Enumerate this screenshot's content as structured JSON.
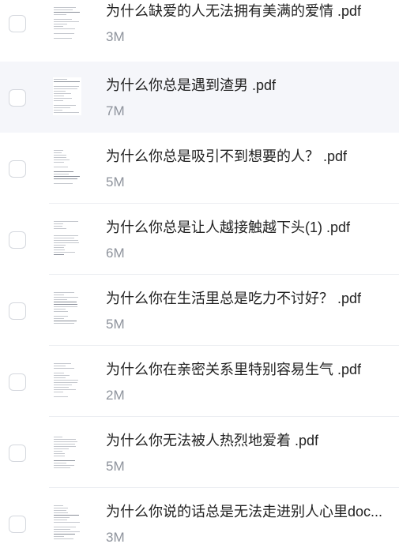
{
  "files": [
    {
      "name": "为什么缺爱的人无法拥有美满的爱情 .pdf",
      "size": "3M",
      "icon": "pdf-thumbnail"
    },
    {
      "name": "为什么你总是遇到渣男 .pdf",
      "size": "7M",
      "icon": "pdf-thumbnail"
    },
    {
      "name": "为什么你总是吸引不到想要的人？ .pdf",
      "size": "5M",
      "icon": "pdf-thumbnail"
    },
    {
      "name": "为什么你总是让人越接触越下头(1) .pdf",
      "size": "6M",
      "icon": "pdf-thumbnail"
    },
    {
      "name": "为什么你在生活里总是吃力不讨好？ .pdf",
      "size": "5M",
      "icon": "pdf-thumbnail"
    },
    {
      "name": "为什么你在亲密关系里特别容易生气 .pdf",
      "size": "2M",
      "icon": "pdf-thumbnail"
    },
    {
      "name": "为什么你无法被人热烈地爱着 .pdf",
      "size": "5M",
      "icon": "pdf-thumbnail"
    },
    {
      "name": "为什么你说的话总是无法走进别人心里doc...",
      "size": "3M",
      "icon": "doc-thumbnail"
    }
  ],
  "highlighted_row": 1,
  "colors": {
    "highlight_bg": "#f5f6fa",
    "title_text": "#222222",
    "size_text": "#8e939c",
    "checkbox_border": "#d5d8de"
  }
}
